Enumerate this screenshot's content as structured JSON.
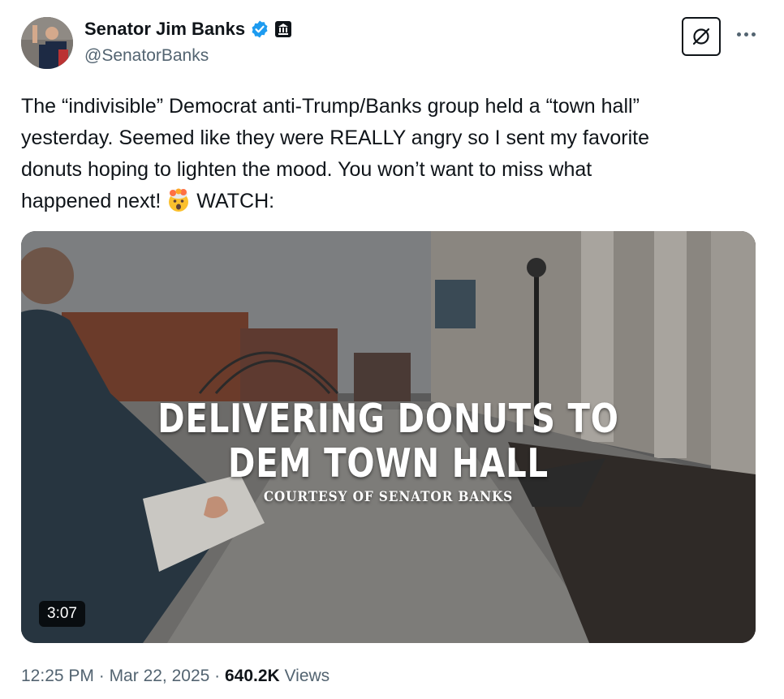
{
  "author": {
    "display_name": "Senator Jim Banks",
    "handle": "@SenatorBanks",
    "verified": true,
    "affiliation_badge": "government-building-icon"
  },
  "tweet": {
    "text": "The “indivisible” Democrat anti-Trump/Banks group held a “town hall”\nyesterday. Seemed like they were REALLY angry so I sent my favorite\ndonuts hoping to lighten the mood. You won’t want to miss what\nhappened next! ",
    "text_tail": " WATCH:",
    "emoji": "shocked-face-exploding-head-emoji"
  },
  "media": {
    "overlay_line1": "DELIVERING  DONUTS  TO",
    "overlay_line2": "DEM  TOWN  HALL",
    "overlay_credit": "COURTESY OF SENATOR BANKS",
    "duration": "3:07"
  },
  "meta": {
    "time": "12:25 PM",
    "separator": " · ",
    "date": "Mar 22, 2025",
    "views_count": "640.2K",
    "views_label": " Views"
  },
  "colors": {
    "text_primary": "#0f1419",
    "text_secondary": "#536471",
    "verified_blue": "#1d9bf0"
  }
}
